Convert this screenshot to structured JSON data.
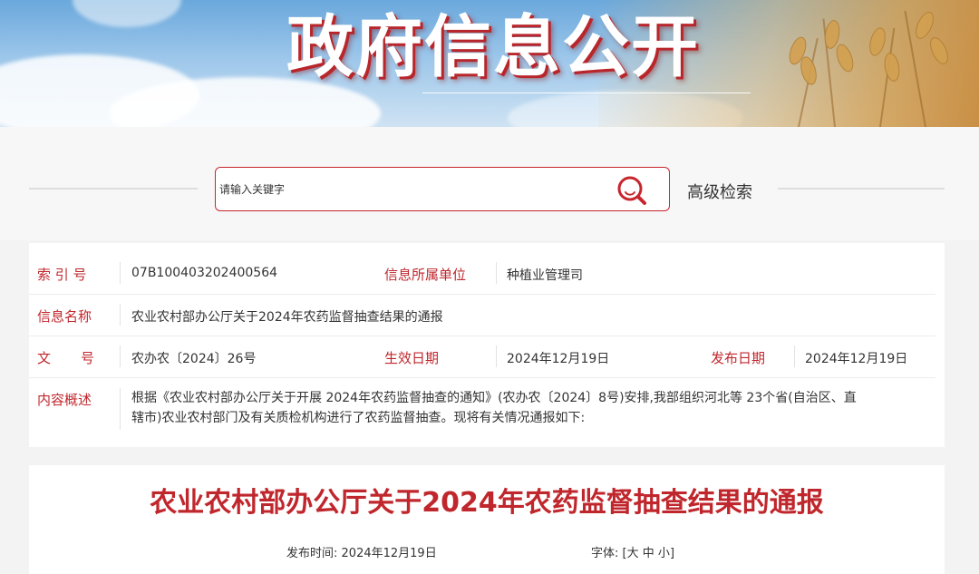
{
  "banner": {
    "title": "政府信息公开"
  },
  "search": {
    "placeholder": "请输入关键字",
    "advanced_label": "高级检索"
  },
  "info": {
    "index_label": "索 引 号",
    "index_value": "07B100403202400564",
    "dept_label": "信息所属单位",
    "dept_value": "种植业管理司",
    "name_label": "信息名称",
    "name_value": "农业农村部办公厅关于2024年农药监督抽查结果的通报",
    "doc_label_a": "文",
    "doc_label_b": "号",
    "doc_value": "农办农〔2024〕26号",
    "effective_label": "生效日期",
    "effective_value": "2024年12月19日",
    "publish_label": "发布日期",
    "publish_value": "2024年12月19日",
    "summary_label": "内容概述",
    "summary_line1": "根据《农业农村部办公厅关于开展 2024年农药监督抽查的通知》(农办农〔2024〕8号)安排,我部组织河北等 23个省(自治区、直",
    "summary_line2": "辖市)农业农村部门及有关质检机构进行了农药监督抽查。现将有关情况通报如下:"
  },
  "article": {
    "title": "农业农村部办公厅关于2024年农药监督抽查结果的通报",
    "publish_time_label": "发布时间:",
    "publish_time_value": "2024年12月19日",
    "font_label": "字体:",
    "font_open": "[",
    "font_large": "大",
    "font_medium": "中",
    "font_small": "小",
    "font_close": "]"
  },
  "colors": {
    "accent": "#c0272d",
    "banner_sky": "#6aa8dc",
    "wheat": "#c98f45"
  },
  "icons": {
    "search": "search-icon"
  }
}
